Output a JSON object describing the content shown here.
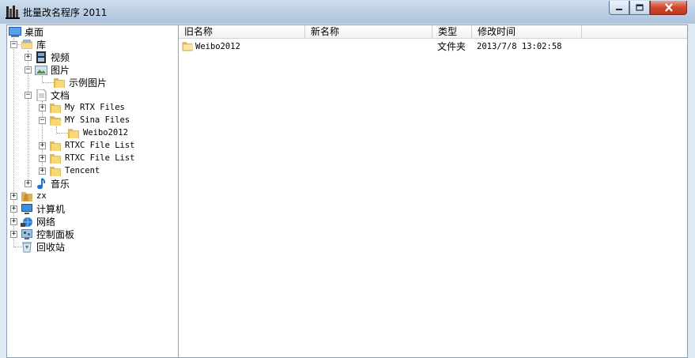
{
  "window": {
    "title": "批量改名程序 2011",
    "buttons": {
      "minimize": "minimize",
      "maximize": "maximize",
      "close": "close"
    }
  },
  "tree": {
    "desktop": "桌面",
    "library": "库",
    "video": "视频",
    "pictures": "图片",
    "sample_pictures": "示例图片",
    "documents": "文档",
    "my_rtx_files": "My RTX Files",
    "my_sina_files": "MY Sina Files",
    "weibo2012": "Weibo2012",
    "rtxc_file_list_1": "RTXC File List",
    "rtxc_file_list_2": "RTXC File List",
    "tencent": "Tencent",
    "music": "音乐",
    "zx": "zx",
    "computer": "计算机",
    "network": "网络",
    "control_panel": "控制面板",
    "recycle_bin": "回收站"
  },
  "list": {
    "columns": {
      "old_name": "旧名称",
      "new_name": "新名称",
      "type": "类型",
      "modified": "修改时间"
    },
    "rows": [
      {
        "old_name": "Weibo2012",
        "new_name": "",
        "type": "文件夹",
        "modified": "2013/7/8 13:02:58"
      }
    ]
  },
  "colors": {
    "folder": "#f1cf63",
    "selection": "#3399ff",
    "title_gradient_top": "#cfdff0"
  }
}
